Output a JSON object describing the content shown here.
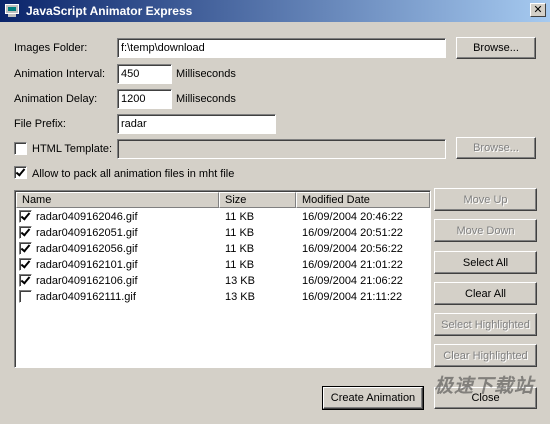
{
  "window": {
    "title": "JavaScript Animator Express",
    "close_label": "✕"
  },
  "form": {
    "images_folder": {
      "label": "Images Folder:",
      "value": "f:\\temp\\download",
      "browse_label": "Browse..."
    },
    "animation_interval": {
      "label": "Animation Interval:",
      "value": "450",
      "unit": "Milliseconds"
    },
    "animation_delay": {
      "label": "Animation Delay:",
      "value": "1200",
      "unit": "Milliseconds"
    },
    "file_prefix": {
      "label": "File Prefix:",
      "value": "radar"
    },
    "html_template": {
      "label": "HTML Template:",
      "value": "",
      "checked": false,
      "browse_label": "Browse..."
    },
    "pack_mht": {
      "label": "Allow to pack all animation files in mht file",
      "checked": true
    }
  },
  "file_list": {
    "columns": [
      "Name",
      "Size",
      "Modified Date"
    ],
    "rows": [
      {
        "checked": true,
        "name": "radar0409162046.gif",
        "size": "11 KB",
        "modified": "16/09/2004 20:46:22"
      },
      {
        "checked": true,
        "name": "radar0409162051.gif",
        "size": "11 KB",
        "modified": "16/09/2004 20:51:22"
      },
      {
        "checked": true,
        "name": "radar0409162056.gif",
        "size": "11 KB",
        "modified": "16/09/2004 20:56:22"
      },
      {
        "checked": true,
        "name": "radar0409162101.gif",
        "size": "11 KB",
        "modified": "16/09/2004 21:01:22"
      },
      {
        "checked": true,
        "name": "radar0409162106.gif",
        "size": "13 KB",
        "modified": "16/09/2004 21:06:22"
      },
      {
        "checked": false,
        "name": "radar0409162111.gif",
        "size": "13 KB",
        "modified": "16/09/2004 21:11:22"
      }
    ]
  },
  "side_buttons": {
    "move_up": "Move Up",
    "move_down": "Move Down",
    "select_all": "Select All",
    "clear_all": "Clear All",
    "select_highlighted": "Select Highlighted",
    "clear_highlighted": "Clear Highlighted"
  },
  "bottom_buttons": {
    "create_animation": "Create Animation",
    "close": "Close"
  },
  "watermark": "极速下载站"
}
